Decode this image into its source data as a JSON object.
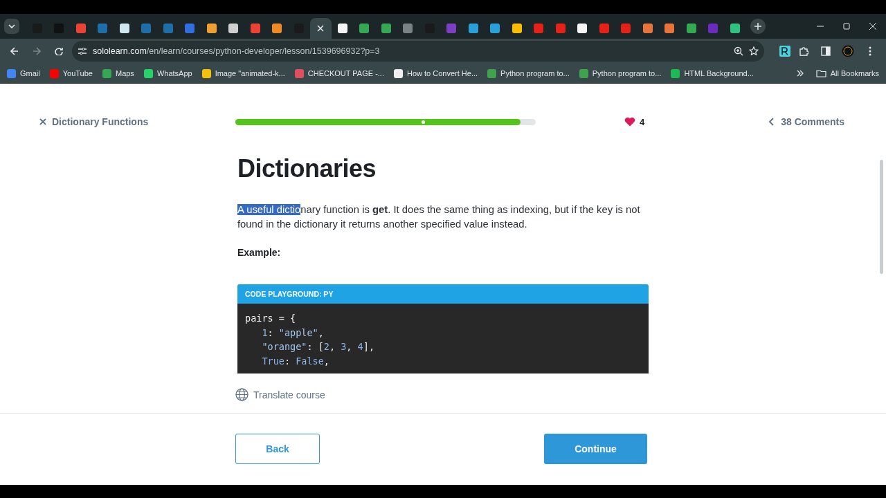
{
  "browser": {
    "tabs": [
      {
        "color": "#1a1a1a",
        "selected": false
      },
      {
        "color": "#111111",
        "selected": false
      },
      {
        "color": "#ea4335",
        "selected": false
      },
      {
        "color": "#1e6fa8",
        "selected": false
      },
      {
        "color": "#cfe8f0",
        "selected": false
      },
      {
        "color": "#1e6fa8",
        "selected": false
      },
      {
        "color": "#1e6fa8",
        "selected": false
      },
      {
        "color": "#2f6fe0",
        "selected": false
      },
      {
        "color": "#f0a030",
        "selected": false
      },
      {
        "color": "#d0d0d0",
        "selected": false
      },
      {
        "color": "#ea4335",
        "selected": false
      },
      {
        "color": "#f08a24",
        "selected": false
      },
      {
        "color": "#1a1a1a",
        "selected": false
      },
      {
        "selected": true
      },
      {
        "color": "#f5f5f5",
        "selected": false
      },
      {
        "color": "#34a853",
        "selected": false
      },
      {
        "color": "#34a853",
        "selected": false
      },
      {
        "color": "#7a8285",
        "selected": false
      },
      {
        "color": "#1a1a1a",
        "selected": false
      },
      {
        "color": "#7b3fc4",
        "selected": false
      },
      {
        "color": "#2aa0d8",
        "selected": false
      },
      {
        "color": "#2aa0d8",
        "selected": false
      },
      {
        "color": "#fbbc04",
        "selected": false
      },
      {
        "color": "#e62117",
        "selected": false
      },
      {
        "color": "#e62117",
        "selected": false
      },
      {
        "color": "#f5f5f5",
        "selected": false
      },
      {
        "color": "#e62117",
        "selected": false
      },
      {
        "color": "#e62117",
        "selected": false
      },
      {
        "color": "#e8743b",
        "selected": false
      },
      {
        "color": "#e8743b",
        "selected": false
      },
      {
        "color": "#34a853",
        "selected": false
      },
      {
        "color": "#6a2bbf",
        "selected": false
      },
      {
        "color": "#2ec27e",
        "selected": false
      }
    ],
    "url": {
      "host": "sololearn.com",
      "path": "/en/learn/courses/python-developer/lesson/1539696932?p=3"
    },
    "bookmarks": [
      {
        "label": "Gmail",
        "color": "#4285f4"
      },
      {
        "label": "YouTube",
        "color": "#ff0000"
      },
      {
        "label": "Maps",
        "color": "#34a853"
      },
      {
        "label": "WhatsApp",
        "color": "#25d366"
      },
      {
        "label": "Image \"animated-k...",
        "color": "#f4c20d"
      },
      {
        "label": "CHECKOUT PAGE -...",
        "color": "#e04f5f"
      },
      {
        "label": "How to Convert He...",
        "color": "#f0f0f0"
      },
      {
        "label": "Python program to...",
        "color": "#3fa34d"
      },
      {
        "label": "Python program to...",
        "color": "#3fa34d"
      },
      {
        "label": "HTML Background...",
        "color": "#1db954"
      }
    ],
    "all_bookmarks": "All Bookmarks"
  },
  "lesson": {
    "close_label": "Dictionary Functions",
    "progress": {
      "level": 0.95
    },
    "hearts": "4",
    "comments": "38 Comments",
    "title": "Dictionaries",
    "paragraph": {
      "selected_text": "A useful dictio",
      "text": "nary function is **get**. It does the same thing as indexing, but if the key is not found in the dictionary it returns another specified value instead."
    },
    "example_label": "Example:",
    "code": {
      "header": "CODE PLAYGROUND: PY",
      "lines": [
        {
          "indented": false,
          "tokens": [
            {
              "kind": "plain",
              "text": "pairs = {"
            }
          ]
        },
        {
          "indented": true,
          "tokens": [
            {
              "kind": "number",
              "text": "1"
            },
            {
              "kind": "plain",
              "text": ": "
            },
            {
              "kind": "string",
              "text": "\"apple\""
            },
            {
              "kind": "plain",
              "text": ","
            }
          ]
        },
        {
          "indented": true,
          "tokens": [
            {
              "kind": "string",
              "text": "\"orange\""
            },
            {
              "kind": "plain",
              "text": ": ["
            },
            {
              "kind": "number",
              "text": "2"
            },
            {
              "kind": "plain",
              "text": ", "
            },
            {
              "kind": "number",
              "text": "3"
            },
            {
              "kind": "plain",
              "text": ", "
            },
            {
              "kind": "number",
              "text": "4"
            },
            {
              "kind": "plain",
              "text": "],"
            }
          ]
        },
        {
          "indented": true,
          "tokens": [
            {
              "kind": "keyword",
              "text": "True"
            },
            {
              "kind": "plain",
              "text": ": "
            },
            {
              "kind": "keyword",
              "text": "False"
            },
            {
              "kind": "plain",
              "text": ","
            }
          ]
        }
      ]
    },
    "translate": "Translate course",
    "buttons": [
      {
        "label": "Back",
        "kind": "outline"
      },
      {
        "label": "Continue",
        "kind": "primary"
      }
    ]
  }
}
